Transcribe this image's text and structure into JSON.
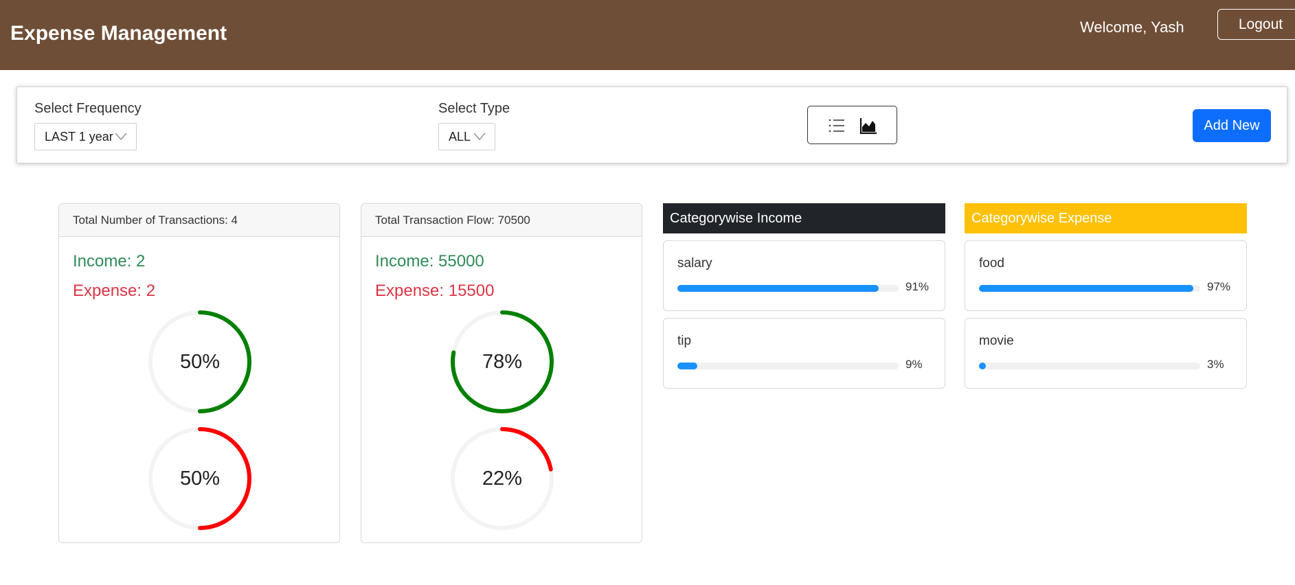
{
  "header": {
    "title": "Expense Management",
    "welcome": "Welcome, Yash",
    "logout_label": "Logout",
    "bg_color": "#6f4e37"
  },
  "filters": {
    "frequency_label": "Select Frequency",
    "frequency_value": "LAST 1 year",
    "type_label": "Select Type",
    "type_value": "ALL",
    "view_icons": [
      "list-icon",
      "area-chart-icon"
    ],
    "add_label": "Add New"
  },
  "cards": [
    {
      "header": "Total Number of Transactions: 4",
      "income": "Income: 2",
      "expense": "Expense: 2",
      "income_pct": 50,
      "income_pct_label": "50%",
      "expense_pct": 50,
      "expense_pct_label": "50%"
    },
    {
      "header": "Total Transaction Flow: 70500",
      "income": "Income: 55000",
      "expense": "Expense: 15500",
      "income_pct": 78,
      "income_pct_label": "78%",
      "expense_pct": 22,
      "expense_pct_label": "22%"
    }
  ],
  "categories": {
    "income": {
      "title": "Categorywise Income",
      "color": "#212529",
      "items": [
        {
          "name": "salary",
          "pct": 91,
          "label": "91%"
        },
        {
          "name": "tip",
          "pct": 9,
          "label": "9%"
        }
      ]
    },
    "expense": {
      "title": "Categorywise Expense",
      "color": "#ffc107",
      "items": [
        {
          "name": "food",
          "pct": 97,
          "label": "97%"
        },
        {
          "name": "movie",
          "pct": 3,
          "label": "3%"
        }
      ]
    }
  },
  "colors": {
    "income_ring": "#008000",
    "expense_ring": "#ff0000",
    "ring_track": "#f3f3f3",
    "progress": "#1890ff",
    "primary": "#0d6efd"
  }
}
